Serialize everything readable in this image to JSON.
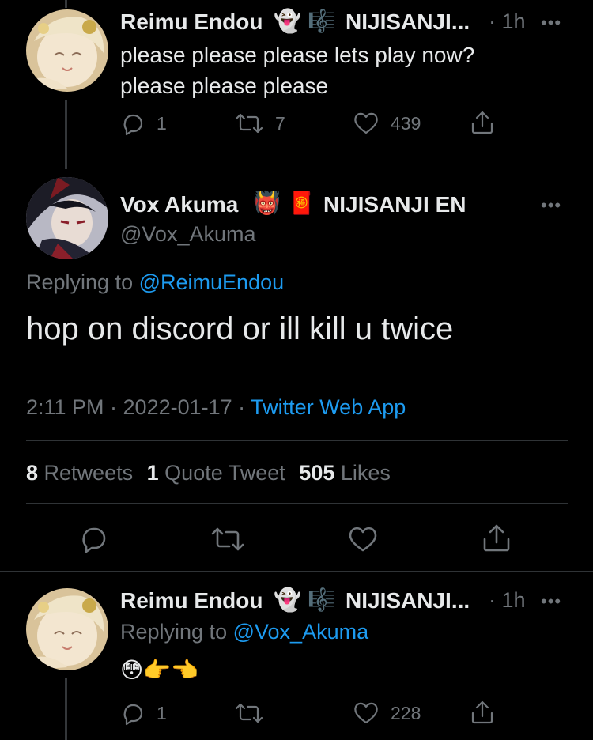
{
  "reply1": {
    "name": "Reimu Endou",
    "org": "NIJISANJI...",
    "time": "· 1h",
    "more": "•••",
    "text_line1": "please please please lets play now?",
    "text_line2": "please please please",
    "replies": "1",
    "retweets": "7",
    "likes": "439"
  },
  "main": {
    "name": "Vox Akuma",
    "org": "NIJISANJI EN",
    "handle": "@Vox_Akuma",
    "more": "•••",
    "replying_prefix": "Replying to",
    "replying_handle": "@ReimuEndou",
    "text": "hop on discord or ill kill u twice",
    "timestamp": "2:11 PM · 2022-01-17 ·",
    "source": "Twitter Web App",
    "stats": {
      "retweets_count": "8",
      "retweets_label": "Retweets",
      "quotes_count": "1",
      "quotes_label": "Quote Tweet",
      "likes_count": "505",
      "likes_label": "Likes"
    }
  },
  "reply2": {
    "name": "Reimu Endou",
    "org": "NIJISANJI...",
    "time": "· 1h",
    "more": "•••",
    "replying_prefix": "Replying to",
    "replying_handle": "@Vox_Akuma",
    "replies": "1",
    "retweets": "",
    "likes": "228"
  },
  "colors": {
    "background": "#000000",
    "text": "#e7e9ea",
    "muted": "#71767b",
    "link": "#1d9bf0",
    "divider": "#2f3336"
  }
}
